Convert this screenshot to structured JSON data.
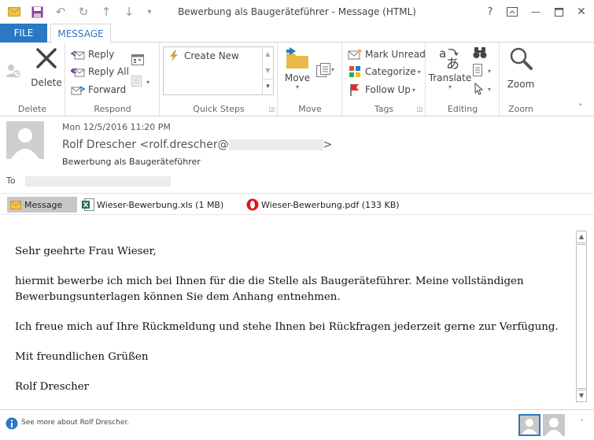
{
  "window": {
    "title": "Bewerbung als Baugeräteführer - Message (HTML)",
    "help": "?",
    "minimize": "—",
    "close": "✕"
  },
  "tabs": {
    "file": "FILE",
    "message": "MESSAGE"
  },
  "ribbon": {
    "delete_group": {
      "label": "Delete",
      "delete": "Delete"
    },
    "respond_group": {
      "label": "Respond",
      "reply": "Reply",
      "reply_all": "Reply All",
      "forward": "Forward"
    },
    "quicksteps_group": {
      "label": "Quick Steps",
      "create_new": "Create New"
    },
    "move_group": {
      "label": "Move",
      "move": "Move"
    },
    "tags_group": {
      "label": "Tags",
      "mark_unread": "Mark Unread",
      "categorize": "Categorize",
      "follow_up": "Follow Up"
    },
    "editing_group": {
      "label": "Editing",
      "translate": "Translate"
    },
    "zoom_group": {
      "label": "Zoom",
      "zoom": "Zoom"
    }
  },
  "message": {
    "date": "Mon 12/5/2016 11:20 PM",
    "sender_name": "Rolf Drescher <rolf.drescher@",
    "sender_close": ">",
    "subject": "Bewerbung als Baugeräteführer",
    "to_label": "To",
    "attachments": [
      {
        "label": "Message"
      },
      {
        "label": "Wieser-Bewerbung.xls (1 MB)"
      },
      {
        "label": "Wieser-Bewerbung.pdf (133 KB)"
      }
    ],
    "body": {
      "greeting": "Sehr geehrte Frau Wieser,",
      "para1": "hiermit bewerbe ich mich bei Ihnen für die die Stelle als Baugeräteführer. Meine vollständigen Bewerbungsunterlagen können Sie dem Anhang entnehmen.",
      "para2": "Ich freue mich auf Ihre Rückmeldung und stehe Ihnen bei Rückfragen jederzeit gerne zur Verfügung.",
      "closing": "Mit freundlichen Grüßen",
      "signature": "Rolf Drescher"
    }
  },
  "footer": {
    "people_text": "See more about Rolf Drescher."
  },
  "colors": {
    "accent": "#2b78c4",
    "file_tab": "#2b78c4"
  }
}
